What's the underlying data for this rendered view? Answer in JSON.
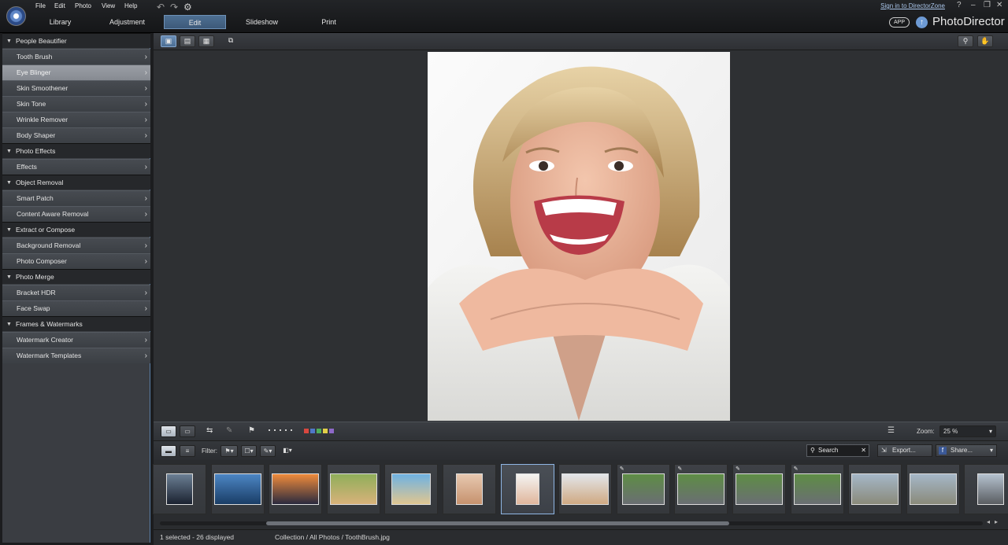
{
  "menu": [
    "File",
    "Edit",
    "Photo",
    "View",
    "Help"
  ],
  "toolbar_icons": [
    "undo-icon",
    "redo-icon",
    "settings-gear-icon"
  ],
  "tabs": [
    {
      "label": "Library",
      "active": false
    },
    {
      "label": "Adjustment",
      "active": false
    },
    {
      "label": "Edit",
      "active": true
    },
    {
      "label": "Slideshow",
      "active": false
    },
    {
      "label": "Print",
      "active": false
    }
  ],
  "header": {
    "signin_label": "Sign in to DirectorZone",
    "help_label": "?",
    "app_badge": "APP",
    "brand": "PhotoDirector"
  },
  "sidebar": {
    "sections": [
      {
        "title": "People Beautifier",
        "items": [
          "Tooth Brush",
          "Eye Blinger",
          "Skin Smoothener",
          "Skin Tone",
          "Wrinkle Remover",
          "Body Shaper"
        ]
      },
      {
        "title": "Photo Effects",
        "items": [
          "Effects"
        ]
      },
      {
        "title": "Object Removal",
        "items": [
          "Smart Patch",
          "Content Aware Removal"
        ]
      },
      {
        "title": "Extract or Compose",
        "items": [
          "Background Removal",
          "Photo Composer"
        ]
      },
      {
        "title": "Photo Merge",
        "items": [
          "Bracket HDR",
          "Face Swap"
        ]
      },
      {
        "title": "Frames & Watermarks",
        "items": [
          "Watermark Creator",
          "Watermark Templates"
        ]
      }
    ],
    "highlighted_item": "Eye Blinger"
  },
  "bottom_toolbar": {
    "zoom_label": "Zoom:",
    "zoom_value": "25 %",
    "color_labels": [
      "#d8473f",
      "#4f78c8",
      "#4fae5a",
      "#e2cf48",
      "#8d68c8"
    ]
  },
  "filter_bar": {
    "filter_label": "Filter:",
    "search_placeholder": "Search",
    "export_label": "Export...",
    "share_label": "Share..."
  },
  "filmstrip": {
    "thumbnails": [
      {
        "subject": "lake landscape",
        "selected": false,
        "edited": false
      },
      {
        "subject": "mountain lake",
        "selected": false,
        "edited": false
      },
      {
        "subject": "sunset",
        "selected": false,
        "edited": false
      },
      {
        "subject": "cat",
        "selected": false,
        "edited": false
      },
      {
        "subject": "beach",
        "selected": false,
        "edited": false
      },
      {
        "subject": "woman portrait",
        "selected": false,
        "edited": false
      },
      {
        "subject": "smiling woman",
        "selected": true,
        "edited": false
      },
      {
        "subject": "blonde woman",
        "selected": false,
        "edited": false
      },
      {
        "subject": "husky dog",
        "selected": false,
        "edited": true
      },
      {
        "subject": "husky dog",
        "selected": false,
        "edited": true
      },
      {
        "subject": "husky dog",
        "selected": false,
        "edited": true
      },
      {
        "subject": "husky dog",
        "selected": false,
        "edited": true
      },
      {
        "subject": "people on beach",
        "selected": false,
        "edited": false
      },
      {
        "subject": "people on beach",
        "selected": false,
        "edited": false
      },
      {
        "subject": "person on beach",
        "selected": false,
        "edited": false
      }
    ]
  },
  "status": {
    "selection": "1 selected - 26 displayed",
    "path": "Collection / All Photos / ToothBrush.jpg"
  }
}
